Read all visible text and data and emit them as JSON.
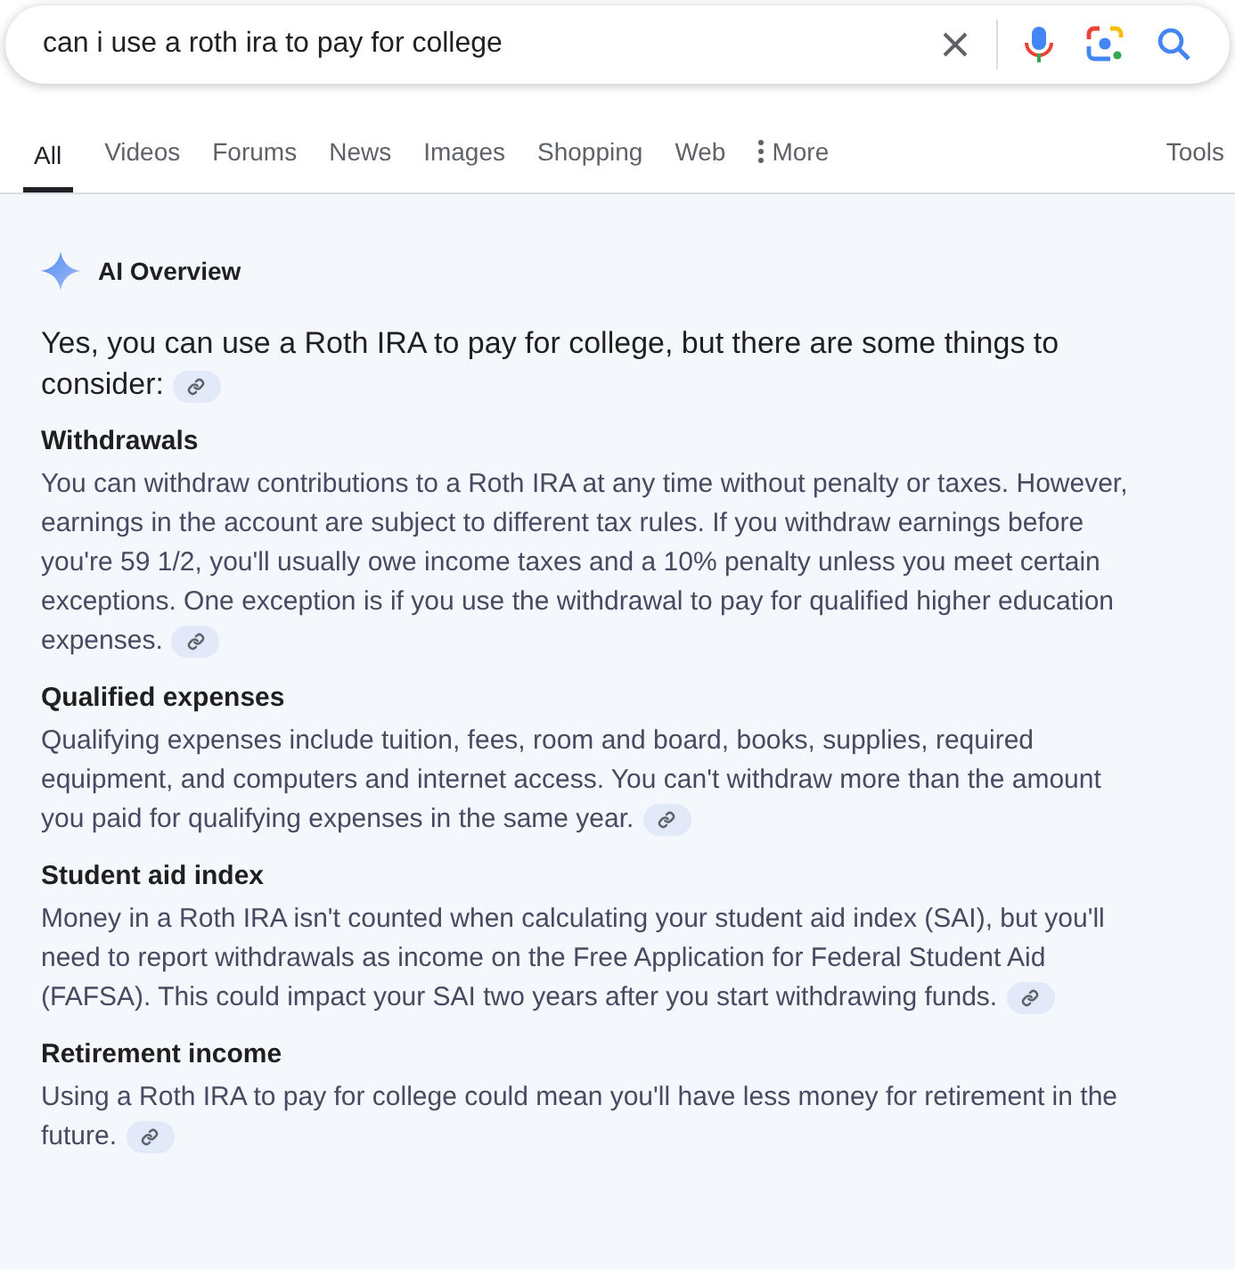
{
  "search": {
    "query": "can i use a roth ira to pay for college"
  },
  "tabs": [
    {
      "label": "All",
      "selected": true,
      "kind": "plain"
    },
    {
      "label": "Videos",
      "selected": false,
      "kind": "plain"
    },
    {
      "label": "Forums",
      "selected": false,
      "kind": "plain"
    },
    {
      "label": "News",
      "selected": false,
      "kind": "plain"
    },
    {
      "label": "Images",
      "selected": false,
      "kind": "plain"
    },
    {
      "label": "Shopping",
      "selected": false,
      "kind": "plain"
    },
    {
      "label": "Web",
      "selected": false,
      "kind": "plain"
    },
    {
      "label": "More",
      "selected": false,
      "kind": "menu"
    }
  ],
  "tools": "Tools",
  "ai_overview": {
    "title": "AI Overview",
    "summary": "Yes, you can use a Roth IRA to pay for college, but there are some things to consider:",
    "sections": [
      {
        "heading": "Withdrawals",
        "body": "You can withdraw contributions to a Roth IRA at any time without penalty or taxes. However, earnings in the account are subject to different tax rules. If you withdraw earnings before you're 59 1/2, you'll usually owe income taxes and a 10% penalty unless you meet certain exceptions. One exception is if you use the withdrawal to pay for qualified higher education expenses."
      },
      {
        "heading": "Qualified expenses",
        "body": "Qualifying expenses include tuition, fees, room and board, books, supplies, required equipment, and computers and internet access. You can't withdraw more than the amount you paid for qualifying expenses in the same year."
      },
      {
        "heading": "Student aid index",
        "body": "Money in a Roth IRA isn't counted when calculating your student aid index (SAI), but you'll need to report withdrawals as income on the Free Application for Federal Student Aid (FAFSA). This could impact your SAI two years after you start withdrawing funds."
      },
      {
        "heading": "Retirement income",
        "body": "Using a Roth IRA to pay for college could mean you'll have less money for retirement in the future."
      }
    ]
  }
}
